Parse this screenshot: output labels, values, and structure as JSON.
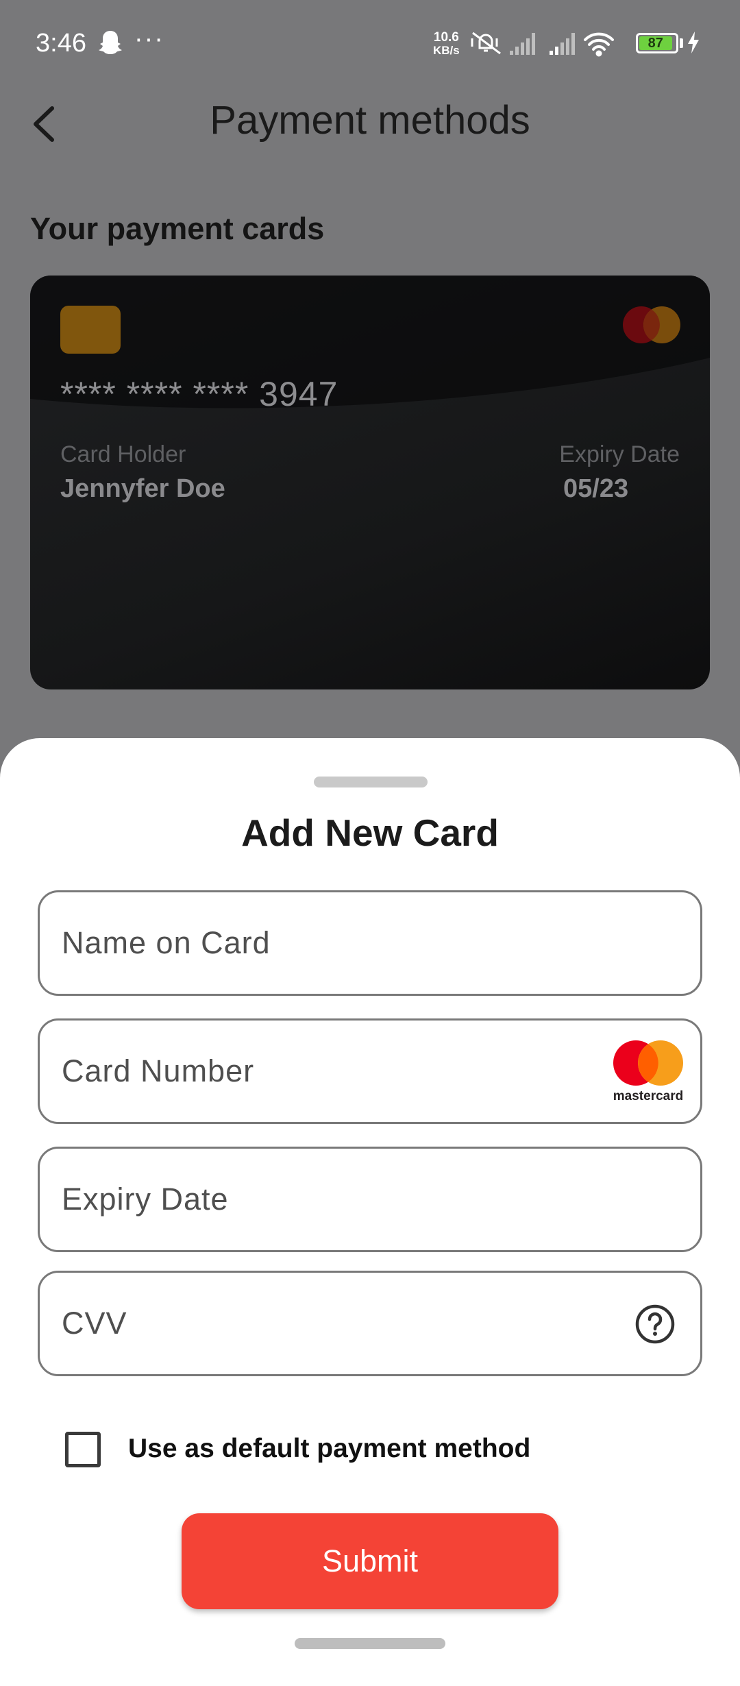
{
  "status_bar": {
    "time": "3:46",
    "more": "···",
    "net_speed_value": "10.6",
    "net_speed_unit": "KB/s",
    "battery_level": "87",
    "icons": [
      "snapchat-ghost-icon",
      "mute-vibrate-icon",
      "signal-icon",
      "signal-icon",
      "wifi-icon",
      "battery-icon",
      "charging-icon"
    ]
  },
  "header": {
    "title": "Payment methods",
    "back_icon": "chevron-left-icon"
  },
  "cards_section": {
    "title": "Your payment cards",
    "card": {
      "number": "**** **** **** 3947",
      "holder_label": "Card Holder",
      "holder_name": "Jennyfer Doe",
      "expiry_label": "Expiry Date",
      "expiry_value": "05/23",
      "brand": "mastercard"
    }
  },
  "sheet": {
    "title": "Add New Card",
    "fields": {
      "name_placeholder": "Name on Card",
      "number_placeholder": "Card Number",
      "expiry_placeholder": "Expiry Date",
      "cvv_placeholder": "CVV"
    },
    "mastercard_label": "mastercard",
    "default_checkbox": {
      "label": "Use as default payment method",
      "checked": false
    },
    "submit_label": "Submit"
  },
  "colors": {
    "accent": "#f44336",
    "overlay": "#78787a",
    "card_bg": "#161718",
    "chip": "#80560d",
    "mastercard_red": "#eb001b",
    "mastercard_orange": "#f79e1b"
  }
}
